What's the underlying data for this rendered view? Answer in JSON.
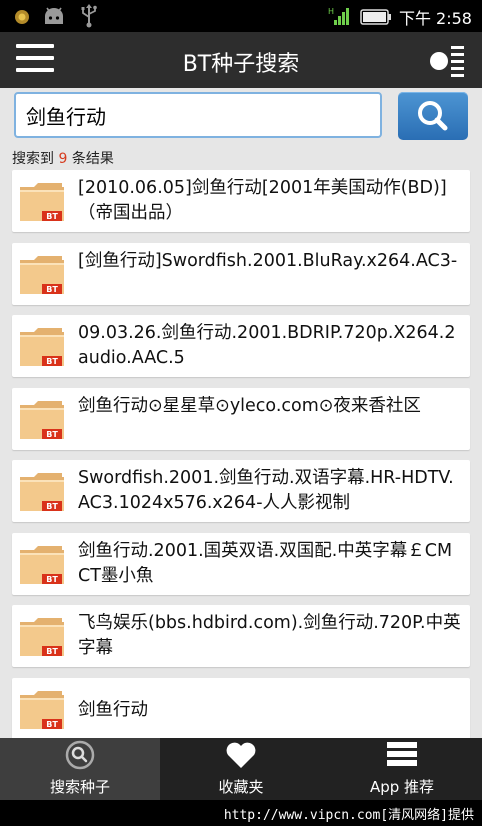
{
  "status_bar": {
    "time": "下午 2:58",
    "icons": [
      "notification-dot-icon",
      "android-icon",
      "usb-icon",
      "signal-icon",
      "battery-icon"
    ]
  },
  "header": {
    "title": "BT种子搜索",
    "menu_icon": "hamburger-menu-icon",
    "options_icon": "options-toggle-icon"
  },
  "search": {
    "value": "剑鱼行动",
    "button_icon": "search-icon"
  },
  "result_count": {
    "prefix": "搜索到",
    "count": "9",
    "suffix": "条结果"
  },
  "results": [
    {
      "text": "[2010.06.05]剑鱼行动[2001年美国动作(BD)]（帝国出品）",
      "badge": "BT"
    },
    {
      "text": "[剑鱼行动]Swordfish.2001.BluRay.x264.AC3-",
      "badge": "BT"
    },
    {
      "text": "09.03.26.剑鱼行动.2001.BDRIP.720p.X264.2audio.AAC.5",
      "badge": "BT"
    },
    {
      "text": "剑鱼行动⊙星星草⊙yleco.com⊙夜来香社区",
      "badge": "BT"
    },
    {
      "text": "Swordfish.2001.剑鱼行动.双语字幕.HR-HDTV.AC3.1024x576.x264-人人影视制",
      "badge": "BT"
    },
    {
      "text": "剑鱼行动.2001.国英双语.双国配.中英字幕￡CMCT墨小魚",
      "badge": "BT"
    },
    {
      "text": "飞鸟娱乐(bbs.hdbird.com).剑鱼行动.720P.中英字幕",
      "badge": "BT"
    },
    {
      "text": "剑鱼行动",
      "badge": "BT"
    }
  ],
  "bottom_tabs": [
    {
      "label": "搜索种子",
      "icon": "search-seed-icon",
      "active": true
    },
    {
      "label": "收藏夹",
      "icon": "heart-icon",
      "active": false
    },
    {
      "label": "App 推荐",
      "icon": "stack-icon",
      "active": false
    }
  ],
  "footer": {
    "text": "http://www.vipcn.com[清风网络]提供"
  },
  "colors": {
    "header_bg": "#2d2d2d",
    "search_button": "#3a82c4",
    "count_highlight": "#d63b1e",
    "folder": "#f3c98c",
    "badge": "#d9321a"
  }
}
